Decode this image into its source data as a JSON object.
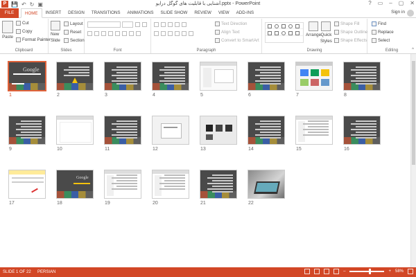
{
  "app": {
    "icon_letter": "P",
    "title": "آشنایی با قابلیت های گوگل درایو.pptx - PowerPoint",
    "window_controls": [
      "?",
      "▭",
      "–",
      "▢",
      "✕"
    ]
  },
  "qat": [
    "💾",
    "↶",
    "↻",
    "▣"
  ],
  "tabs": {
    "file": "FILE",
    "items": [
      "HOME",
      "INSERT",
      "DESIGN",
      "TRANSITIONS",
      "ANIMATIONS",
      "SLIDE SHOW",
      "REVIEW",
      "VIEW",
      "ADD-INS"
    ],
    "active": "HOME",
    "signin": "Sign in"
  },
  "ribbon": {
    "clipboard": {
      "label": "Clipboard",
      "paste": "Paste",
      "cut": "Cut",
      "copy": "Copy",
      "format_painter": "Format Painter"
    },
    "slides": {
      "label": "Slides",
      "new_slide": "New",
      "new_slide_2": "Slide",
      "layout": "Layout",
      "reset": "Reset",
      "section": "Section"
    },
    "font": {
      "label": "Font"
    },
    "paragraph": {
      "label": "Paragraph",
      "text_direction": "Text Direction",
      "align_text": "Align Text",
      "convert_smartart": "Convert to SmartArt"
    },
    "drawing": {
      "label": "Drawing",
      "arrange": "Arrange",
      "quick_styles": "Quick",
      "quick_styles_2": "Styles",
      "shape_fill": "Shape Fill",
      "shape_outline": "Shape Outline",
      "shape_effects": "Shape Effects"
    },
    "editing": {
      "label": "Editing",
      "find": "Find",
      "replace": "Replace",
      "select": "Select"
    }
  },
  "slides": [
    {
      "n": "1",
      "kind": "title",
      "selected": true
    },
    {
      "n": "2",
      "kind": "text_drive"
    },
    {
      "n": "3",
      "kind": "text"
    },
    {
      "n": "4",
      "kind": "text"
    },
    {
      "n": "5",
      "kind": "screenshot"
    },
    {
      "n": "6",
      "kind": "text"
    },
    {
      "n": "7",
      "kind": "screenshot_grid"
    },
    {
      "n": "8",
      "kind": "text"
    },
    {
      "n": "9",
      "kind": "text"
    },
    {
      "n": "10",
      "kind": "screenshot_blank"
    },
    {
      "n": "11",
      "kind": "text"
    },
    {
      "n": "12",
      "kind": "screenshot_dialog"
    },
    {
      "n": "13",
      "kind": "screenshot_dark"
    },
    {
      "n": "14",
      "kind": "text"
    },
    {
      "n": "15",
      "kind": "screenshot_list"
    },
    {
      "n": "16",
      "kind": "text"
    },
    {
      "n": "17",
      "kind": "screenshot_yellow"
    },
    {
      "n": "18",
      "kind": "title_small"
    },
    {
      "n": "19",
      "kind": "screenshot_list"
    },
    {
      "n": "20",
      "kind": "screenshot_list"
    },
    {
      "n": "21",
      "kind": "text"
    },
    {
      "n": "22",
      "kind": "photo"
    }
  ],
  "status": {
    "slide": "SLIDE 1 OF 22",
    "language": "PERSIAN",
    "zoom": "58%",
    "zoom_level": 0.58
  },
  "colors": {
    "accent": "#d24726",
    "slide_bg": "#4a4a4a",
    "drive_yellow": "#f4c20d",
    "drive_green": "#0f9d58",
    "drive_blue": "#4285f4"
  }
}
